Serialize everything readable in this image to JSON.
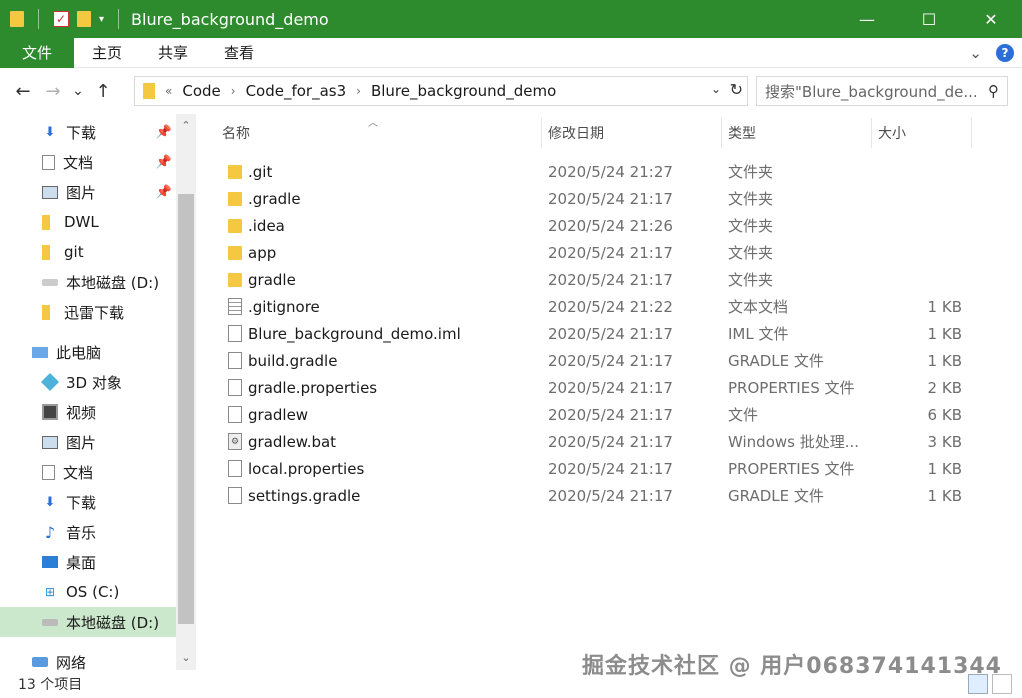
{
  "window": {
    "title": "Blure_background_demo",
    "controls": [
      "—",
      "☐",
      "✕"
    ]
  },
  "ribbon": {
    "tabs": [
      "文件",
      "主页",
      "共享",
      "查看"
    ]
  },
  "navigation": {
    "breadcrumb_prefix": "«",
    "breadcrumbs": [
      "Code",
      "Code_for_as3",
      "Blure_background_demo"
    ],
    "search_placeholder": "搜索\"Blure_background_de...",
    "back": "←",
    "forward": "→",
    "recent": "⌄",
    "up": "↑"
  },
  "sidebar": {
    "items": [
      {
        "label": "下载",
        "icon": "download-arrow-icon",
        "pinned": true
      },
      {
        "label": "文档",
        "icon": "document-icon",
        "pinned": true
      },
      {
        "label": "图片",
        "icon": "picture-icon",
        "pinned": true
      },
      {
        "label": "DWL",
        "icon": "folder-icon",
        "pinned": false
      },
      {
        "label": "git",
        "icon": "folder-icon",
        "pinned": false
      },
      {
        "label": "本地磁盘 (D:)",
        "icon": "drive-icon",
        "pinned": false
      },
      {
        "label": "迅雷下载",
        "icon": "folder-icon",
        "pinned": false
      },
      {
        "label": "此电脑",
        "icon": "computer-icon",
        "pinned": false
      },
      {
        "label": "3D 对象",
        "icon": "cube-icon",
        "pinned": false
      },
      {
        "label": "视频",
        "icon": "video-icon",
        "pinned": false
      },
      {
        "label": "图片",
        "icon": "picture-icon",
        "pinned": false
      },
      {
        "label": "文档",
        "icon": "document-icon",
        "pinned": false
      },
      {
        "label": "下载",
        "icon": "download-arrow-icon",
        "pinned": false
      },
      {
        "label": "音乐",
        "icon": "music-icon",
        "pinned": false
      },
      {
        "label": "桌面",
        "icon": "desktop-icon",
        "pinned": false
      },
      {
        "label": "OS (C:)",
        "icon": "windows-drive-icon",
        "pinned": false
      },
      {
        "label": "本地磁盘 (D:)",
        "icon": "drive-icon",
        "pinned": false,
        "selected": true
      },
      {
        "label": "网络",
        "icon": "network-icon",
        "pinned": false
      }
    ]
  },
  "columns": {
    "name": "名称",
    "date": "修改日期",
    "type": "类型",
    "size": "大小"
  },
  "files": [
    {
      "name": ".git",
      "date": "2020/5/24 21:27",
      "type": "文件夹",
      "size": "",
      "kind": "folder"
    },
    {
      "name": ".gradle",
      "date": "2020/5/24 21:17",
      "type": "文件夹",
      "size": "",
      "kind": "folder"
    },
    {
      "name": ".idea",
      "date": "2020/5/24 21:26",
      "type": "文件夹",
      "size": "",
      "kind": "folder"
    },
    {
      "name": "app",
      "date": "2020/5/24 21:17",
      "type": "文件夹",
      "size": "",
      "kind": "folder"
    },
    {
      "name": "gradle",
      "date": "2020/5/24 21:17",
      "type": "文件夹",
      "size": "",
      "kind": "folder"
    },
    {
      "name": ".gitignore",
      "date": "2020/5/24 21:22",
      "type": "文本文档",
      "size": "1 KB",
      "kind": "text"
    },
    {
      "name": "Blure_background_demo.iml",
      "date": "2020/5/24 21:17",
      "type": "IML 文件",
      "size": "1 KB",
      "kind": "file"
    },
    {
      "name": "build.gradle",
      "date": "2020/5/24 21:17",
      "type": "GRADLE 文件",
      "size": "1 KB",
      "kind": "file"
    },
    {
      "name": "gradle.properties",
      "date": "2020/5/24 21:17",
      "type": "PROPERTIES 文件",
      "size": "2 KB",
      "kind": "file"
    },
    {
      "name": "gradlew",
      "date": "2020/5/24 21:17",
      "type": "文件",
      "size": "6 KB",
      "kind": "file"
    },
    {
      "name": "gradlew.bat",
      "date": "2020/5/24 21:17",
      "type": "Windows 批处理...",
      "size": "3 KB",
      "kind": "bat"
    },
    {
      "name": "local.properties",
      "date": "2020/5/24 21:17",
      "type": "PROPERTIES 文件",
      "size": "1 KB",
      "kind": "file"
    },
    {
      "name": "settings.gradle",
      "date": "2020/5/24 21:17",
      "type": "GRADLE 文件",
      "size": "1 KB",
      "kind": "file"
    }
  ],
  "status": {
    "item_count": "13 个项目"
  },
  "watermark": "掘金技术社区 @ 用户0683741413​44",
  "colors": {
    "titlebar": "#2d8a2d",
    "selected": "#cce8cc",
    "folder": "#f5c842"
  }
}
